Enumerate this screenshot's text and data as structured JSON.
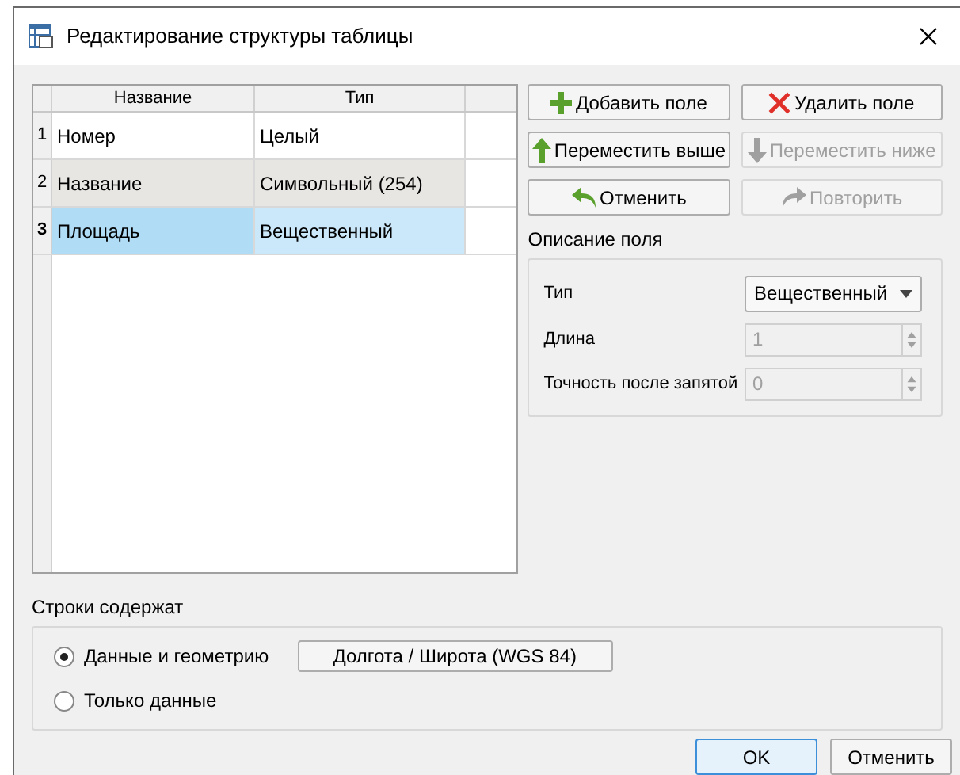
{
  "window": {
    "title": "Редактирование структуры таблицы"
  },
  "table": {
    "columns": [
      "Название",
      "Тип"
    ],
    "rows": [
      {
        "number": "1",
        "name": "Номер",
        "type": "Целый",
        "selected": false
      },
      {
        "number": "2",
        "name": "Название",
        "type": "Символьный (254)",
        "selected": false
      },
      {
        "number": "3",
        "name": "Площадь",
        "type": "Вещественный",
        "selected": true
      }
    ]
  },
  "buttons": [
    {
      "label": "Добавить поле",
      "kind": "plus",
      "disabled": false
    },
    {
      "label": "Удалить поле",
      "kind": "cross",
      "disabled": false
    },
    {
      "label": "Переместить выше",
      "kind": "up",
      "disabled": false
    },
    {
      "label": "Переместить ниже",
      "kind": "down",
      "disabled": true
    },
    {
      "label": "Отменить",
      "kind": "undo",
      "disabled": false
    },
    {
      "label": "Повторить",
      "kind": "redo",
      "disabled": true
    }
  ],
  "field_description": {
    "title": "Описание поля",
    "fields": [
      {
        "kind": "dropdown",
        "label": "Тип",
        "value": "Вещественный",
        "disabled": false
      },
      {
        "kind": "spinbox",
        "label": "Длина",
        "value": "1",
        "disabled": true
      },
      {
        "kind": "spinbox",
        "label": "Точность после запятой",
        "value": "0",
        "disabled": true
      }
    ]
  },
  "rows_contain": {
    "title": "Строки содержат",
    "options": [
      {
        "label": "Данные и геометрию",
        "selected": true
      },
      {
        "label": "Только данные",
        "selected": false
      }
    ],
    "crs_button": "Долгота / Широта (WGS 84)"
  },
  "footer_buttons": [
    {
      "label": "OK",
      "default": true
    },
    {
      "label": "Отменить",
      "default": false
    }
  ]
}
